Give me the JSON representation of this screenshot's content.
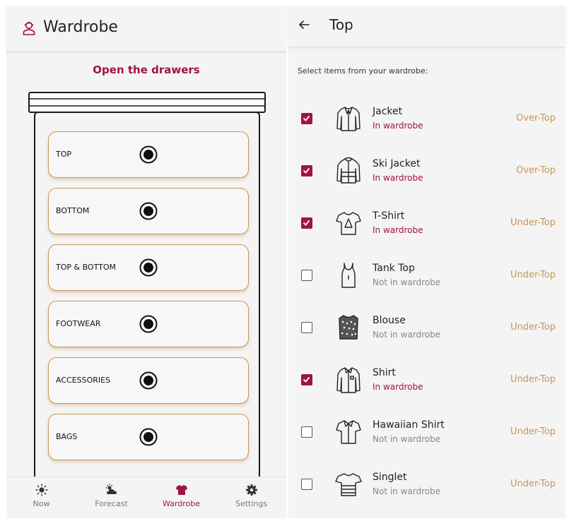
{
  "left": {
    "title": "Wardrobe",
    "logo_icon": "wardrobe-person-icon",
    "heading": "Open the drawers",
    "drawers": [
      {
        "label": "TOP",
        "icon": "knob-icon"
      },
      {
        "label": "BOTTOM",
        "icon": "knob-icon"
      },
      {
        "label": "TOP & BOTTOM",
        "icon": "knob-icon"
      },
      {
        "label": "FOOTWEAR",
        "icon": "knob-icon"
      },
      {
        "label": "ACCESSORIES",
        "icon": "knob-icon"
      },
      {
        "label": "BAGS",
        "icon": "knob-icon"
      }
    ],
    "nav": [
      {
        "label": "Now",
        "icon": "sun-icon",
        "active": false
      },
      {
        "label": "Forecast",
        "icon": "partly-cloudy-icon",
        "active": false
      },
      {
        "label": "Wardrobe",
        "icon": "tshirt-icon",
        "active": true
      },
      {
        "label": "Settings",
        "icon": "gear-icon",
        "active": false
      }
    ]
  },
  "right": {
    "back_icon": "back-arrow-icon",
    "title": "Top",
    "prompt": "Select items from your wardrobe:",
    "items": [
      {
        "name": "Jacket",
        "status": "In wardrobe",
        "category": "Over-Top",
        "checked": true,
        "icon": "jacket-icon"
      },
      {
        "name": "Ski Jacket",
        "status": "In wardrobe",
        "category": "Over-Top",
        "checked": true,
        "icon": "ski-jacket-icon"
      },
      {
        "name": "T-Shirt",
        "status": "In wardrobe",
        "category": "Under-Top",
        "checked": true,
        "icon": "tshirt-icon"
      },
      {
        "name": "Tank Top",
        "status": "Not in wardrobe",
        "category": "Under-Top",
        "checked": false,
        "icon": "tank-top-icon"
      },
      {
        "name": "Blouse",
        "status": "Not in wardrobe",
        "category": "Under-Top",
        "checked": false,
        "icon": "blouse-icon"
      },
      {
        "name": "Shirt",
        "status": "In wardrobe",
        "category": "Under-Top",
        "checked": true,
        "icon": "shirt-icon"
      },
      {
        "name": "Hawaiian Shirt",
        "status": "Not in wardrobe",
        "category": "Under-Top",
        "checked": false,
        "icon": "hawaiian-shirt-icon"
      },
      {
        "name": "Singlet",
        "status": "Not in wardrobe",
        "category": "Under-Top",
        "checked": false,
        "icon": "singlet-icon"
      }
    ]
  },
  "colors": {
    "accent": "#a0153e",
    "drawer_border": "#c9955a",
    "category": "#c9955a",
    "background": "#f4f4f4"
  }
}
